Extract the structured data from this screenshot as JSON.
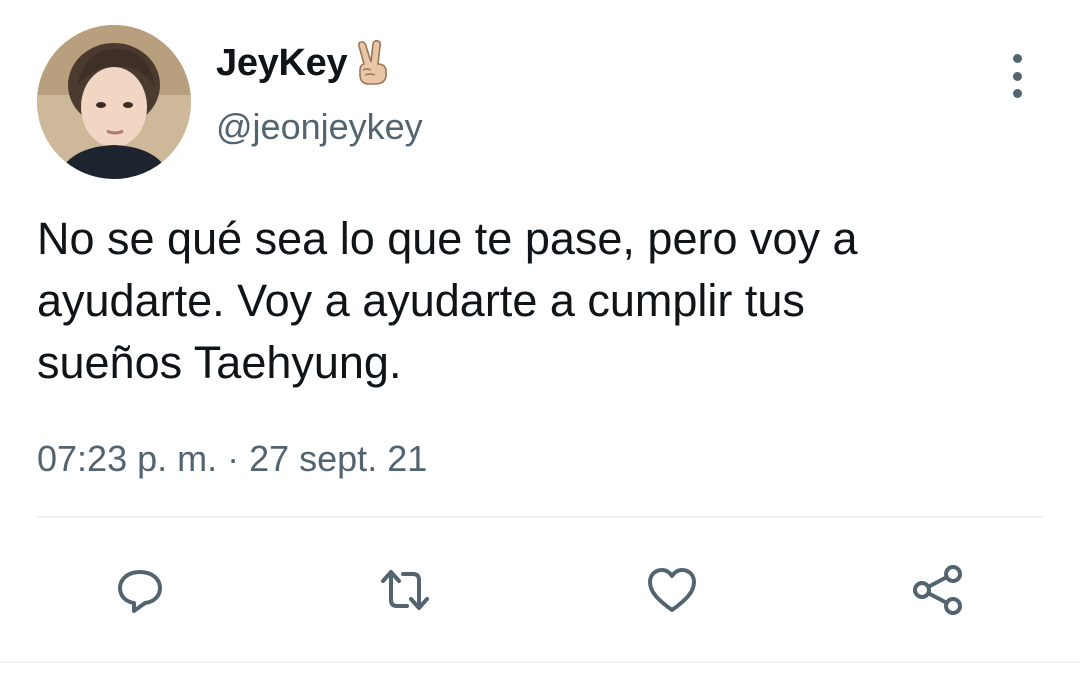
{
  "user": {
    "display_name": "JeyKey",
    "name_emoji": "victory-hand",
    "handle": "@jeonjeykey"
  },
  "tweet": {
    "lines": [
      "No se qué sea lo que te pase, pero voy a",
      "ayudarte. Voy a ayudarte a cumplir tus",
      "sueños Taehyung."
    ],
    "timestamp": "07:23 p. m. · 27 sept. 21"
  },
  "actions": [
    {
      "icon": "reply-icon"
    },
    {
      "icon": "retweet-icon"
    },
    {
      "icon": "like-icon"
    },
    {
      "icon": "share-icon"
    }
  ],
  "colors": {
    "text_primary": "#0f1419",
    "text_secondary": "#536471",
    "icon": "#536471",
    "divider": "#eff3f4"
  }
}
